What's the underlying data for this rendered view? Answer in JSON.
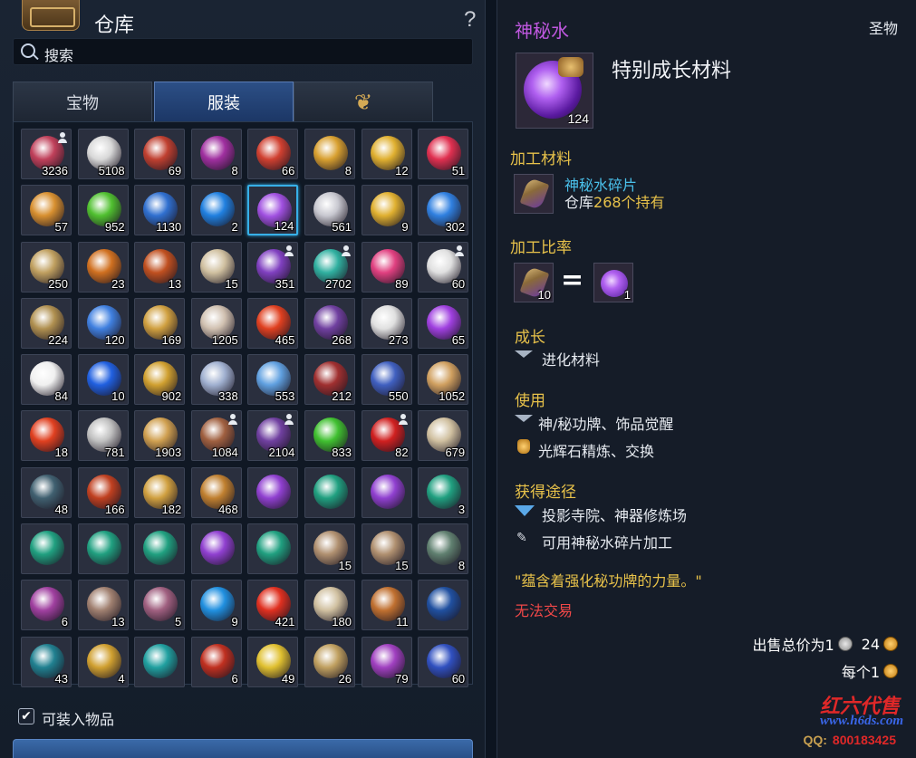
{
  "warehouse": {
    "title": "仓库",
    "search_placeholder": "搜索",
    "help": "?",
    "tabs": [
      {
        "label": "宝物",
        "icon": null,
        "active": false
      },
      {
        "label": "服装",
        "icon": null,
        "active": true
      },
      {
        "label": "",
        "icon": "wings-icon",
        "active": false
      }
    ],
    "slots": [
      {
        "count": "3236",
        "color": "#c0405a",
        "user": true
      },
      {
        "count": "5108",
        "color": "#d8d8d8",
        "user": false
      },
      {
        "count": "69",
        "color": "#c04030",
        "user": false
      },
      {
        "count": "8",
        "color": "#a030a0",
        "user": false
      },
      {
        "count": "66",
        "color": "#d04030",
        "user": false
      },
      {
        "count": "8",
        "color": "#d8a030",
        "user": false
      },
      {
        "count": "12",
        "color": "#e0b030",
        "user": false
      },
      {
        "count": "51",
        "color": "#e03050",
        "user": false
      },
      {
        "count": "57",
        "color": "#d89030",
        "user": false
      },
      {
        "count": "952",
        "color": "#50c030",
        "user": false
      },
      {
        "count": "1130",
        "color": "#3070d0",
        "user": false
      },
      {
        "count": "2",
        "color": "#2080e0",
        "user": false
      },
      {
        "count": "124",
        "color": "#a050e0",
        "user": false,
        "selected": true
      },
      {
        "count": "561",
        "color": "#c8c8d0",
        "user": false
      },
      {
        "count": "9",
        "color": "#e0b030",
        "user": false
      },
      {
        "count": "302",
        "color": "#3080e0",
        "user": false
      },
      {
        "count": "250",
        "color": "#c0a060",
        "user": false
      },
      {
        "count": "23",
        "color": "#d07020",
        "user": false
      },
      {
        "count": "13",
        "color": "#c05020",
        "user": false
      },
      {
        "count": "15",
        "color": "#d0c0a0",
        "user": false
      },
      {
        "count": "351",
        "color": "#8040c0",
        "user": true
      },
      {
        "count": "2702",
        "color": "#30b0a0",
        "user": true
      },
      {
        "count": "89",
        "color": "#e04080",
        "user": false
      },
      {
        "count": "60",
        "color": "#e0e0e0",
        "user": true
      },
      {
        "count": "224",
        "color": "#b09050",
        "user": false
      },
      {
        "count": "120",
        "color": "#4080e0",
        "user": false
      },
      {
        "count": "169",
        "color": "#d0a040",
        "user": false
      },
      {
        "count": "1205",
        "color": "#d0c0b0",
        "user": false
      },
      {
        "count": "465",
        "color": "#e04020",
        "user": false
      },
      {
        "count": "268",
        "color": "#7040a0",
        "user": false
      },
      {
        "count": "273",
        "color": "#e0e0e0",
        "user": false
      },
      {
        "count": "65",
        "color": "#a040e0",
        "user": false
      },
      {
        "count": "84",
        "color": "#f0f0f0",
        "user": false
      },
      {
        "count": "10",
        "color": "#2060e0",
        "user": false
      },
      {
        "count": "902",
        "color": "#d0a030",
        "user": false
      },
      {
        "count": "338",
        "color": "#a0b0d0",
        "user": false
      },
      {
        "count": "553",
        "color": "#60a0e0",
        "user": false
      },
      {
        "count": "212",
        "color": "#a03030",
        "user": false
      },
      {
        "count": "550",
        "color": "#4060c0",
        "user": false
      },
      {
        "count": "1052",
        "color": "#d0a060",
        "user": false
      },
      {
        "count": "18",
        "color": "#e04020",
        "user": false
      },
      {
        "count": "781",
        "color": "#c0c0c0",
        "user": false
      },
      {
        "count": "1903",
        "color": "#d0a050",
        "user": false
      },
      {
        "count": "1084",
        "color": "#a06040",
        "user": true
      },
      {
        "count": "2104",
        "color": "#7040a0",
        "user": true
      },
      {
        "count": "833",
        "color": "#40c030",
        "user": false
      },
      {
        "count": "82",
        "color": "#d02020",
        "user": true
      },
      {
        "count": "679",
        "color": "#d0c0a0",
        "user": false
      },
      {
        "count": "48",
        "color": "#406070",
        "user": false
      },
      {
        "count": "166",
        "color": "#c04020",
        "user": false
      },
      {
        "count": "182",
        "color": "#d0a040",
        "user": false
      },
      {
        "count": "468",
        "color": "#c08030",
        "user": false
      },
      {
        "count": "",
        "color": "#9040d0",
        "user": false
      },
      {
        "count": "",
        "color": "#20a080",
        "user": false
      },
      {
        "count": "",
        "color": "#9040d0",
        "user": false
      },
      {
        "count": "3",
        "color": "#20a080",
        "user": false
      },
      {
        "count": "",
        "color": "#20a080",
        "user": false
      },
      {
        "count": "",
        "color": "#20a080",
        "user": false
      },
      {
        "count": "",
        "color": "#20a080",
        "user": false
      },
      {
        "count": "",
        "color": "#9040d0",
        "user": false
      },
      {
        "count": "",
        "color": "#20a080",
        "user": false
      },
      {
        "count": "15",
        "color": "#b09070",
        "user": false
      },
      {
        "count": "15",
        "color": "#b09070",
        "user": false
      },
      {
        "count": "8",
        "color": "#608070",
        "user": false
      },
      {
        "count": "6",
        "color": "#a040a0",
        "user": false
      },
      {
        "count": "13",
        "color": "#a08070",
        "user": false
      },
      {
        "count": "5",
        "color": "#a06080",
        "user": false
      },
      {
        "count": "9",
        "color": "#2090e0",
        "user": false
      },
      {
        "count": "421",
        "color": "#e03020",
        "user": false
      },
      {
        "count": "180",
        "color": "#d0c0a0",
        "user": false
      },
      {
        "count": "11",
        "color": "#c07030",
        "user": false
      },
      {
        "count": "",
        "color": "#2050a0",
        "user": false
      },
      {
        "count": "43",
        "color": "#208090",
        "user": false
      },
      {
        "count": "4",
        "color": "#d0a030",
        "user": false
      },
      {
        "count": "",
        "color": "#20a0a0",
        "user": false
      },
      {
        "count": "6",
        "color": "#c03020",
        "user": false
      },
      {
        "count": "49",
        "color": "#e0c030",
        "user": false
      },
      {
        "count": "26",
        "color": "#c0a060",
        "user": false
      },
      {
        "count": "79",
        "color": "#a040c0",
        "user": false
      },
      {
        "count": "60",
        "color": "#3050c0",
        "user": false
      }
    ],
    "checkbox_label": "可装入物品",
    "checkbox_checked": true
  },
  "tooltip": {
    "name": "神秘水",
    "grade": "圣物",
    "icon_count": "124",
    "item_type": "特别成长材料",
    "material_header": "加工材料",
    "material_name": "神秘水碎片",
    "material_stock_prefix": "仓库",
    "material_stock_value": "268个持有",
    "ratio_header": "加工比率",
    "ratio_left_count": "10",
    "ratio_equals": "=",
    "ratio_right_count": "1",
    "growth_header": "成长",
    "growth_line": "进化材料",
    "use_header": "使用",
    "use_lines": [
      "神/秘功牌、饰品觉醒",
      "光辉石精炼、交换"
    ],
    "obtain_header": "获得途径",
    "obtain_lines": [
      "投影寺院、神器修炼场",
      "可用神秘水碎片加工"
    ],
    "description": "\"蕴含着强化秘功牌的力量。\"",
    "no_trade": "无法交易",
    "sell_total_label": "出售总价为1",
    "sell_total_gold": "24",
    "each_label": "每个1"
  },
  "watermark": {
    "line1": "红六代售",
    "line2": "www.h6ds.com",
    "qq_label": "QQ:",
    "qq_number": "800183425"
  }
}
